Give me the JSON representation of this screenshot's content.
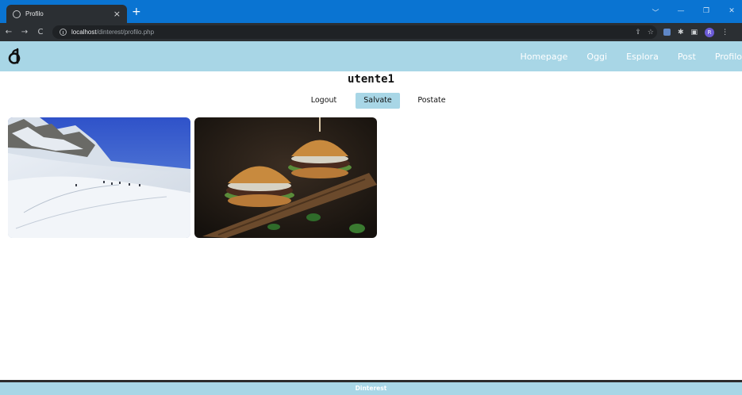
{
  "browser": {
    "tab_title": "Profilo",
    "tab_close": "×",
    "new_tab": "+",
    "url_host": "localhost",
    "url_path": "/dinterest/profilo.php",
    "win_ctrls": [
      "﹀",
      "—",
      "❐",
      "✕"
    ],
    "avatar_letter": "R"
  },
  "navbar": {
    "links": [
      "Homepage",
      "Oggi",
      "Esplora",
      "Post",
      "Profilo"
    ]
  },
  "profile": {
    "username": "utente1",
    "tabs": [
      "Logout",
      "Salvate",
      "Postate"
    ],
    "active_tab": "Salvate"
  },
  "gallery": [
    {
      "icon": "snowy-mountain-image"
    },
    {
      "icon": "burgers-image"
    }
  ],
  "footer": {
    "text": "Dinterest"
  },
  "colors": {
    "navbar": "#a8d6e6",
    "titlebar": "#0a74d2",
    "chrome_dark": "#2b2f33"
  }
}
